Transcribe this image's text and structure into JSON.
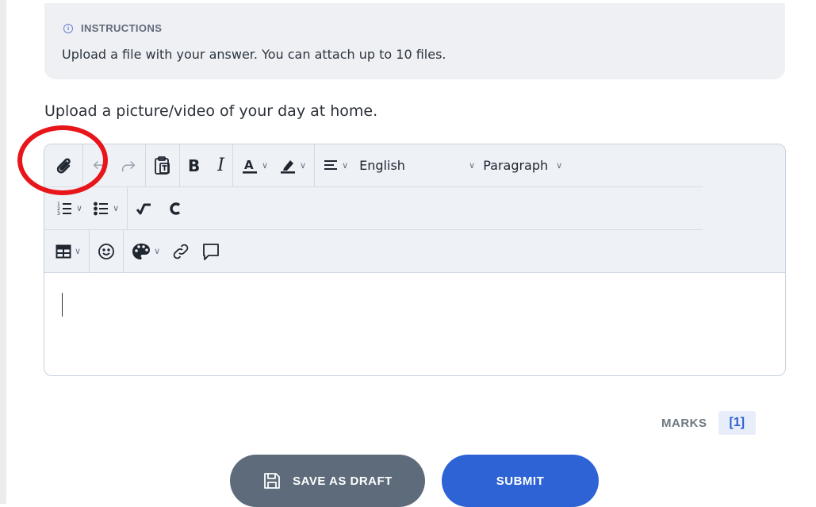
{
  "instructions": {
    "title": "INSTRUCTIONS",
    "icon": "info-icon",
    "text": "Upload a file with your answer. You can attach up to 10 files."
  },
  "question": "Upload a picture/video of your day at home.",
  "toolbar": {
    "language_value": "English",
    "block_format_value": "Paragraph",
    "icons": [
      "attach-icon",
      "undo-icon",
      "redo-icon",
      "paste-text-icon",
      "bold-icon",
      "italic-icon",
      "font-color-icon",
      "highlight-icon",
      "align-icon",
      "numbered-list-icon",
      "bullet-list-icon",
      "math-icon",
      "chemistry-icon",
      "table-icon",
      "emoji-icon",
      "palette-icon",
      "link-icon",
      "comment-icon"
    ]
  },
  "editor": {
    "content": ""
  },
  "marks": {
    "label": "MARKS",
    "value": "[1]"
  },
  "actions": {
    "save_draft": "SAVE AS DRAFT",
    "submit": "SUBMIT"
  },
  "colors": {
    "accent": "#2e63d6",
    "draft": "#5d6b7a",
    "highlight": "#e8151b"
  }
}
